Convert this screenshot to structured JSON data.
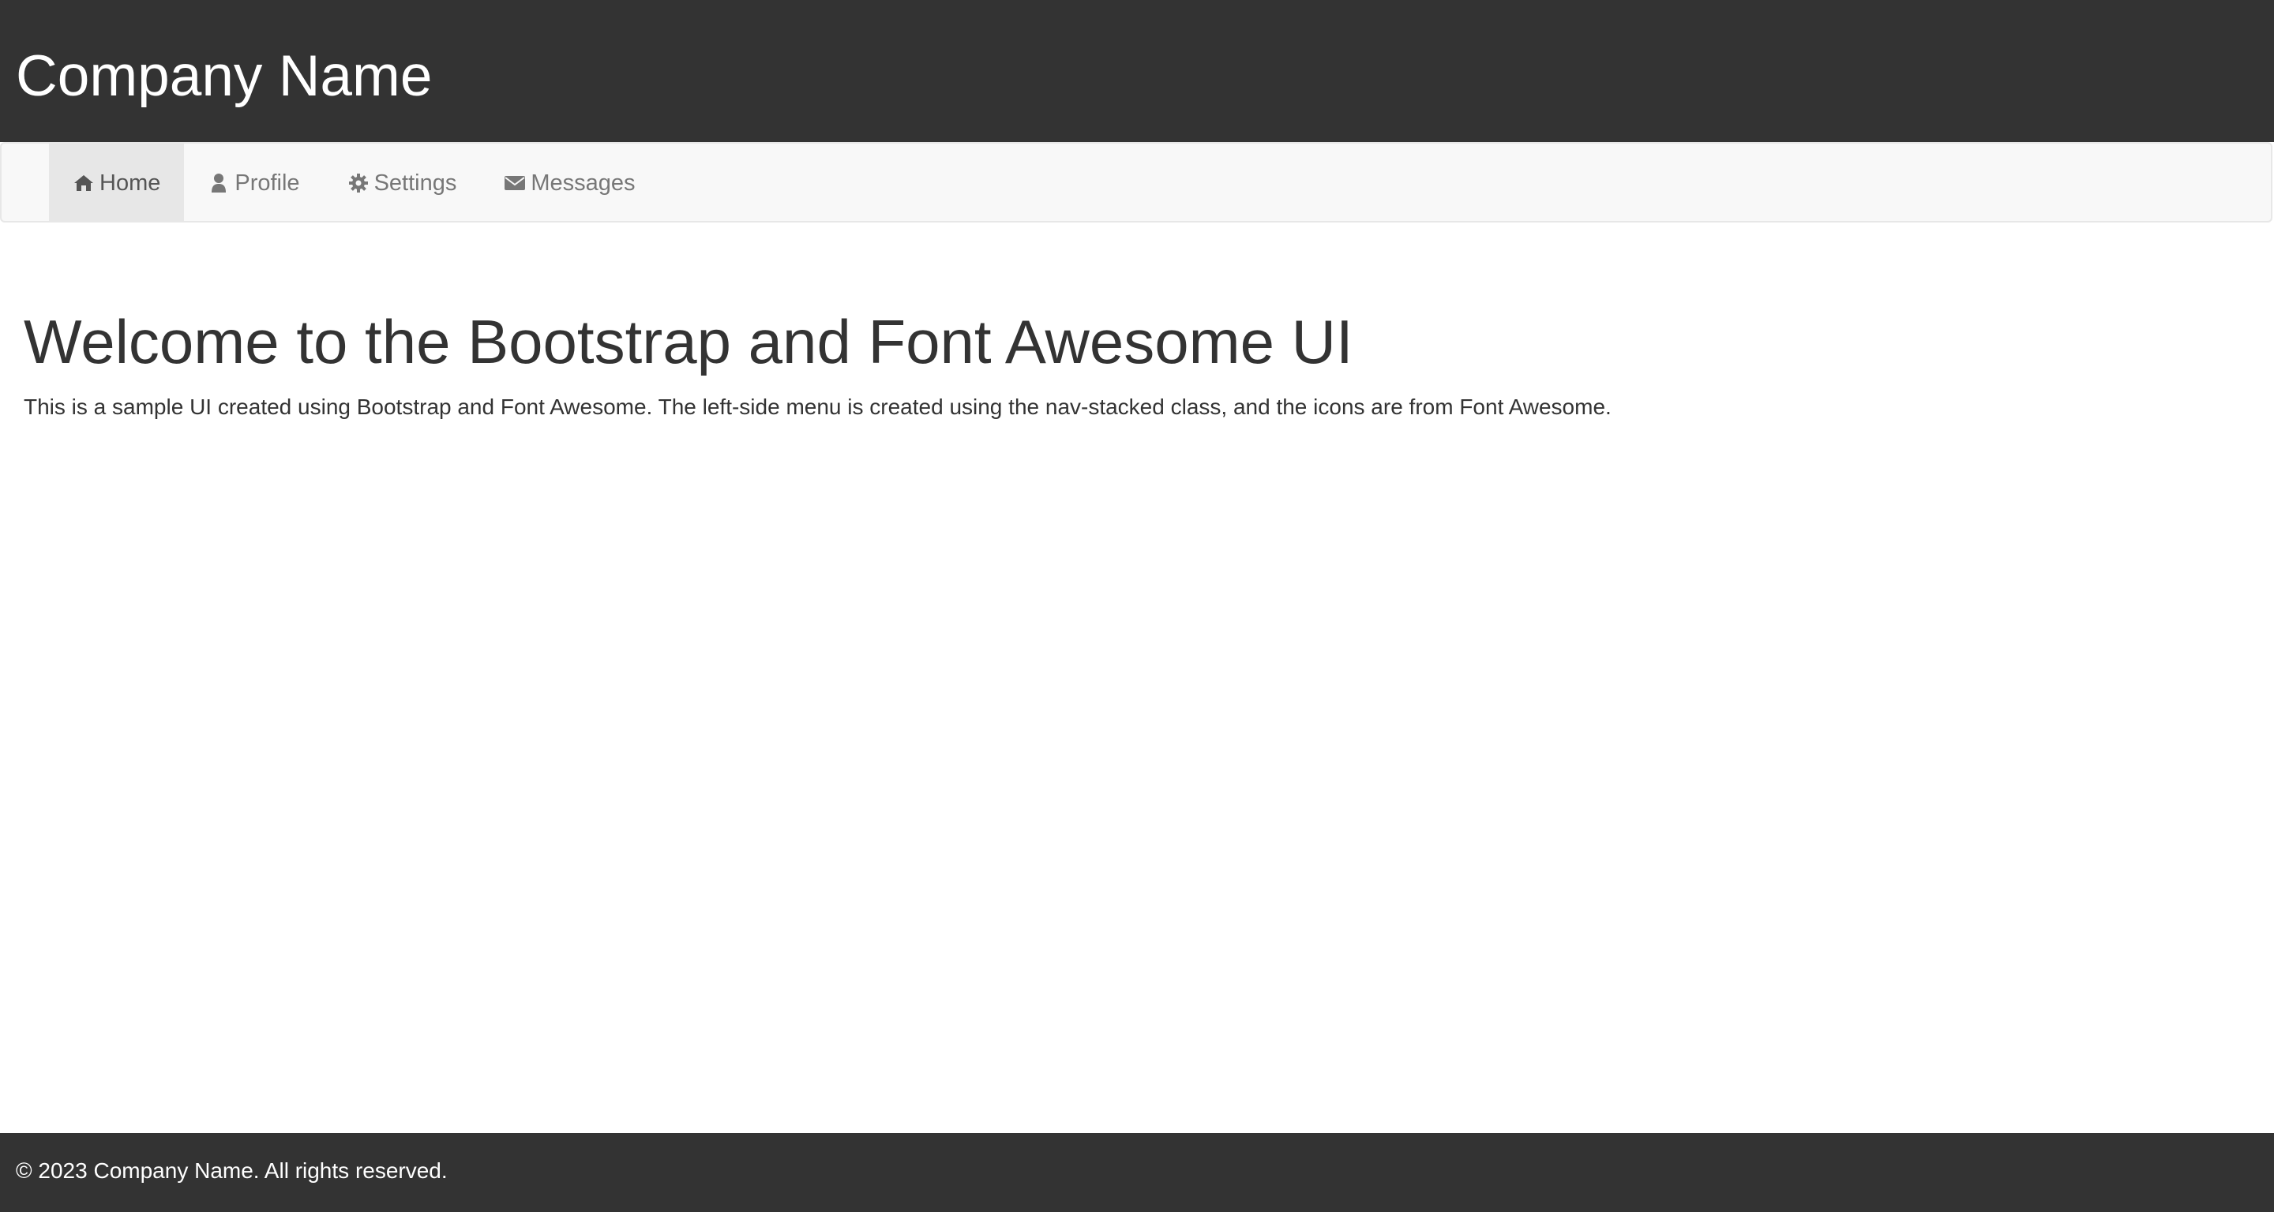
{
  "header": {
    "brand": "Company Name"
  },
  "nav": {
    "items": [
      {
        "label": "Home",
        "icon": "home-icon",
        "active": true
      },
      {
        "label": "Profile",
        "icon": "user-icon",
        "active": false
      },
      {
        "label": "Settings",
        "icon": "gear-icon",
        "active": false
      },
      {
        "label": "Messages",
        "icon": "envelope-icon",
        "active": false
      }
    ]
  },
  "main": {
    "title": "Welcome to the Bootstrap and Font Awesome UI",
    "description": "This is a sample UI created using Bootstrap and Font Awesome. The left-side menu is created using the nav-stacked class, and the icons are from Font Awesome."
  },
  "footer": {
    "text": "© 2023 Company Name. All rights reserved."
  },
  "colors": {
    "header_bg": "#333333",
    "navbar_bg": "#f8f8f8",
    "active_item_bg": "#e7e7e7",
    "nav_text": "#777777",
    "body_text": "#333333"
  }
}
